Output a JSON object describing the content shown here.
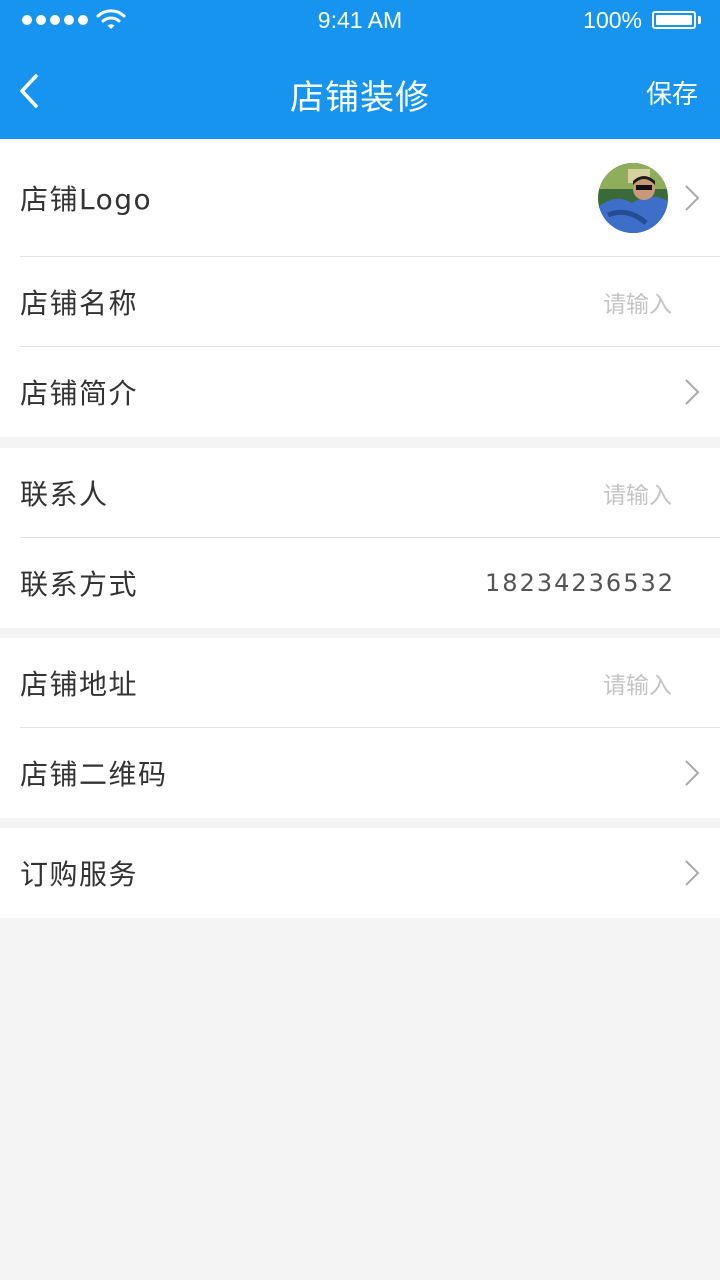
{
  "status_bar": {
    "time": "9:41 AM",
    "battery": "100%"
  },
  "nav": {
    "title": "店铺装修",
    "save_label": "保存"
  },
  "rows": {
    "logo": {
      "label": "店铺Logo"
    },
    "name": {
      "label": "店铺名称",
      "placeholder": "请输入"
    },
    "intro": {
      "label": "店铺简介"
    },
    "contact_person": {
      "label": "联系人",
      "placeholder": "请输入"
    },
    "contact_method": {
      "label": "联系方式",
      "value": "18234236532"
    },
    "address": {
      "label": "店铺地址",
      "placeholder": "请输入"
    },
    "qr_code": {
      "label": "店铺二维码"
    },
    "subscribe": {
      "label": "订购服务"
    }
  },
  "colors": {
    "primary": "#1794f0",
    "background": "#f4f4f4",
    "text": "#333333",
    "placeholder": "#c4c4c4"
  },
  "icons": [
    "wifi-icon",
    "battery-icon",
    "back-icon",
    "chevron-right-icon"
  ]
}
